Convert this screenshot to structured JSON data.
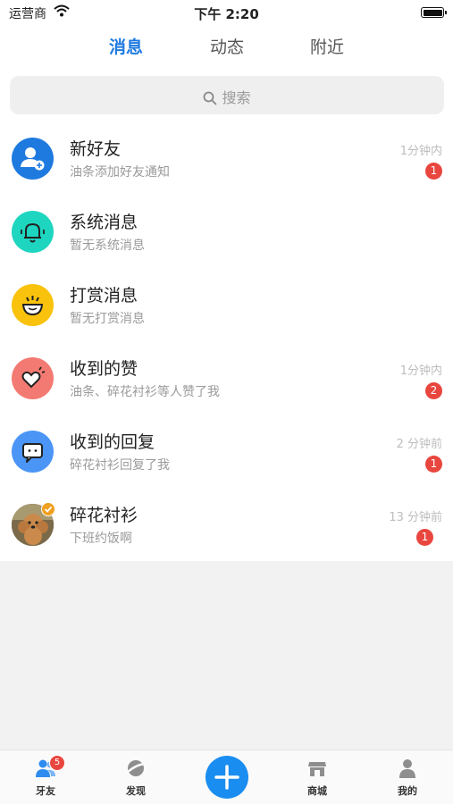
{
  "status_bar": {
    "carrier": "运营商",
    "time": "下午 2:20"
  },
  "tabs": [
    {
      "label": "消息",
      "active": true
    },
    {
      "label": "动态",
      "active": false
    },
    {
      "label": "附近",
      "active": false
    }
  ],
  "search": {
    "placeholder": "搜索"
  },
  "messages": [
    {
      "title": "新好友",
      "subtitle": "油条添加好友通知",
      "time": "1分钟内",
      "badge": "1",
      "icon": "add-user-icon",
      "color": "#1f7ae0"
    },
    {
      "title": "系统消息",
      "subtitle": "暂无系统消息",
      "time": "",
      "badge": "",
      "icon": "bell-icon",
      "color": "#1ed6c0"
    },
    {
      "title": "打赏消息",
      "subtitle": "暂无打赏消息",
      "time": "",
      "badge": "",
      "icon": "reward-bowl-icon",
      "color": "#f9c20c"
    },
    {
      "title": "收到的赞",
      "subtitle": "油条、碎花衬衫等人赞了我",
      "time": "1分钟内",
      "badge": "2",
      "icon": "heart-icon",
      "color": "#f37a72"
    },
    {
      "title": "收到的回复",
      "subtitle": "碎花衬衫回复了我",
      "time": "2 分钟前",
      "badge": "1",
      "icon": "chat-bubble-icon",
      "color": "#4a95f5"
    },
    {
      "title": "碎花衬衫",
      "subtitle": "下班约饭啊",
      "time": "13 分钟前",
      "badge": "1",
      "icon": "dog-avatar",
      "color": "#8b6a3e"
    }
  ],
  "tabbar": [
    {
      "label": "牙友",
      "icon": "friends-icon",
      "badge": "5",
      "active": true
    },
    {
      "label": "发现",
      "icon": "planet-icon"
    },
    {
      "label": "",
      "icon": "plus-icon"
    },
    {
      "label": "商城",
      "icon": "shop-icon"
    },
    {
      "label": "我的",
      "icon": "profile-icon"
    }
  ],
  "colors": {
    "accent": "#1f7ae0",
    "badge": "#e8463e",
    "fab": "#1a8df0"
  }
}
